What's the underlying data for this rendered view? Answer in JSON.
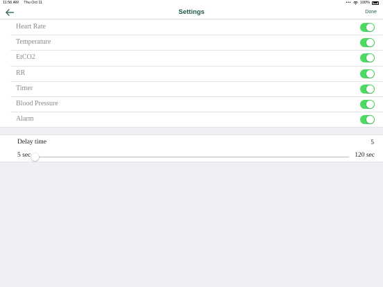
{
  "status_bar": {
    "time": "11:56 AM",
    "date": "Thu Oct 11",
    "battery": "100%"
  },
  "nav": {
    "title": "Settings",
    "done_label": "Done",
    "back_icon": "arrow-left-icon"
  },
  "toggles": [
    {
      "label": "Heart Rate",
      "on": true
    },
    {
      "label": "Temperature",
      "on": true
    },
    {
      "label": "EtCO2",
      "on": true
    },
    {
      "label": "RR",
      "on": true
    },
    {
      "label": "Timer",
      "on": true
    },
    {
      "label": "Blood Pressure",
      "on": true
    },
    {
      "label": "Alarm",
      "on": true
    }
  ],
  "delay": {
    "label": "Delay time",
    "value": "5",
    "min_label": "5 sec",
    "max_label": "120 sec",
    "min": 5,
    "max": 120,
    "current": 5
  },
  "colors": {
    "accent": "#1f5a4b",
    "switch_on": "#4cd964",
    "background": "#efeff4"
  }
}
